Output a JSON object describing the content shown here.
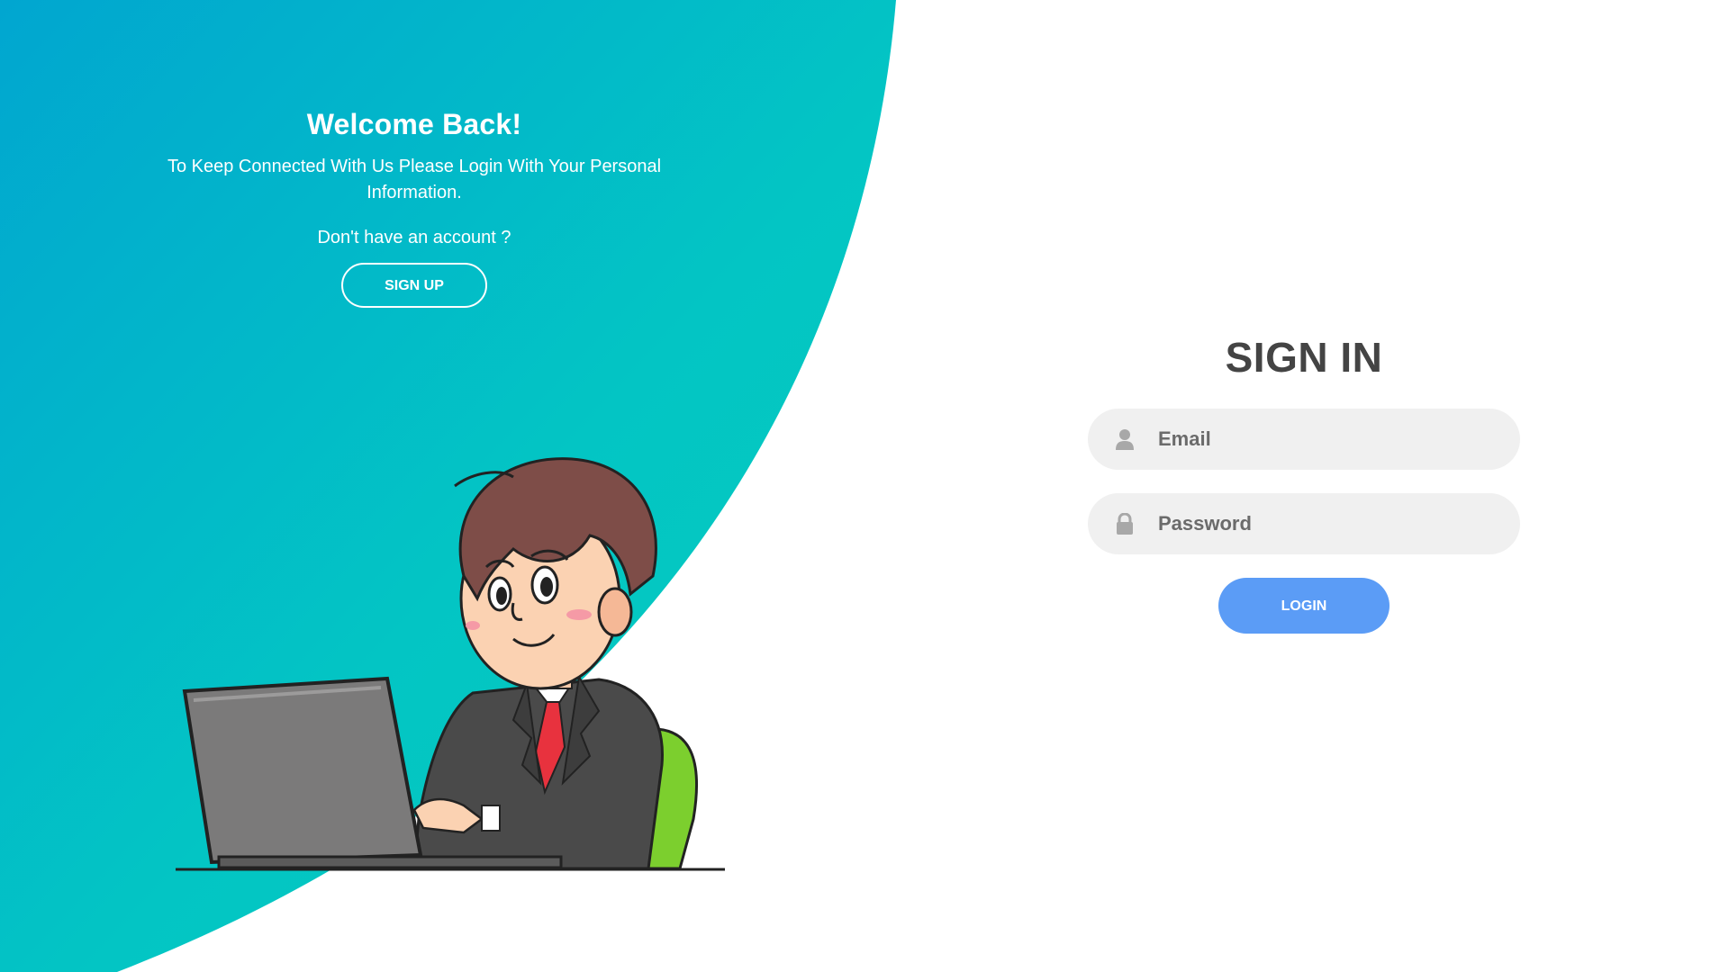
{
  "welcome": {
    "title": "Welcome Back!",
    "description": "To Keep Connected With Us Please Login With Your Personal Information.",
    "prompt": "Don't have an account ?",
    "signup_label": "SIGN UP"
  },
  "signin": {
    "title": "SIGN IN",
    "email_placeholder": "Email",
    "password_placeholder": "Password",
    "login_label": "LOGIN"
  },
  "icons": {
    "email": "user-icon",
    "password": "lock-icon"
  },
  "colors": {
    "gradient_start": "#01a8cf",
    "gradient_end": "#02c9c0",
    "login_button": "#5b9cf6",
    "field_bg": "#f0f0f0",
    "heading": "#444444"
  }
}
